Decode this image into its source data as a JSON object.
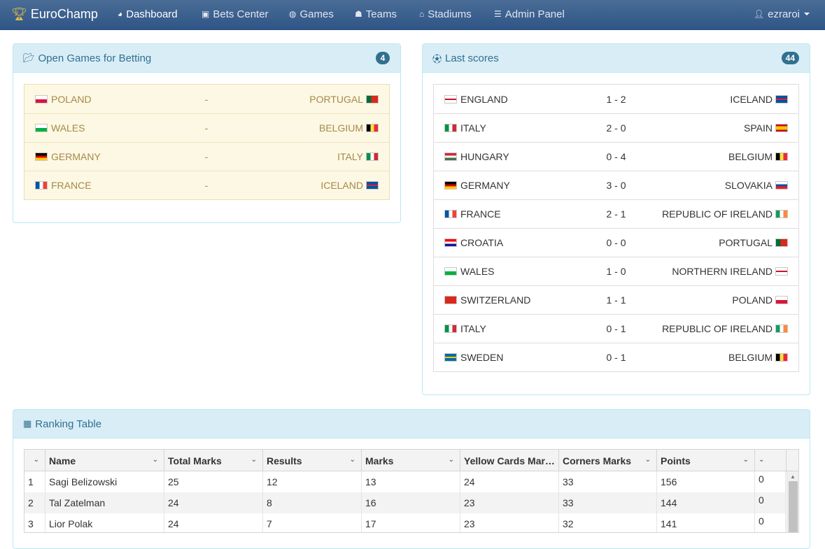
{
  "nav": {
    "brand": "EuroChamp",
    "items": [
      {
        "label": "Dashboard",
        "icon": "dashboard-icon",
        "glyph": "◕"
      },
      {
        "label": "Bets Center",
        "icon": "money-icon",
        "glyph": "▣"
      },
      {
        "label": "Games",
        "icon": "gamepad-icon",
        "glyph": "◍"
      },
      {
        "label": "Teams",
        "icon": "users-icon",
        "glyph": "☗"
      },
      {
        "label": "Stadiums",
        "icon": "home-icon",
        "glyph": "⌂"
      },
      {
        "label": "Admin Panel",
        "icon": "list-icon",
        "glyph": "☰"
      }
    ],
    "user": "ezraroi"
  },
  "open_games": {
    "title": "Open Games for Betting",
    "count": "4",
    "games": [
      {
        "home": "POLAND",
        "sep": "-",
        "away": "PORTUGAL"
      },
      {
        "home": "WALES",
        "sep": "-",
        "away": "BELGIUM"
      },
      {
        "home": "GERMANY",
        "sep": "-",
        "away": "ITALY"
      },
      {
        "home": "FRANCE",
        "sep": "-",
        "away": "ICELAND"
      }
    ]
  },
  "last_scores": {
    "title": "Last scores",
    "count": "44",
    "games": [
      {
        "home": "ENGLAND",
        "score": "1 - 2",
        "away": "ICELAND"
      },
      {
        "home": "ITALY",
        "score": "2 - 0",
        "away": "SPAIN"
      },
      {
        "home": "HUNGARY",
        "score": "0 - 4",
        "away": "BELGIUM"
      },
      {
        "home": "GERMANY",
        "score": "3 - 0",
        "away": "SLOVAKIA"
      },
      {
        "home": "FRANCE",
        "score": "2 - 1",
        "away": "REPUBLIC OF IRELAND"
      },
      {
        "home": "CROATIA",
        "score": "0 - 0",
        "away": "PORTUGAL"
      },
      {
        "home": "WALES",
        "score": "1 - 0",
        "away": "NORTHERN IRELAND"
      },
      {
        "home": "SWITZERLAND",
        "score": "1 - 1",
        "away": "POLAND"
      },
      {
        "home": "ITALY",
        "score": "0 - 1",
        "away": "REPUBLIC OF IRELAND"
      },
      {
        "home": "SWEDEN",
        "score": "0 - 1",
        "away": "BELGIUM"
      }
    ]
  },
  "ranking": {
    "title": "Ranking Table",
    "columns": [
      "",
      "Name",
      "Total Marks",
      "Results",
      "Marks",
      "Yellow Cards Mar…",
      "Corners Marks",
      "Points",
      ""
    ],
    "rows": [
      [
        "1",
        "Sagi Belizowski",
        "25",
        "12",
        "13",
        "24",
        "33",
        "156",
        "0"
      ],
      [
        "2",
        "Tal Zatelman",
        "24",
        "8",
        "16",
        "23",
        "33",
        "144",
        "0"
      ],
      [
        "3",
        "Lior Polak",
        "24",
        "7",
        "17",
        "23",
        "32",
        "141",
        "0"
      ]
    ]
  },
  "colors": {
    "navbar": "#2f5587",
    "panel_heading_bg": "#d9edf7",
    "panel_heading_text": "#31708f",
    "warning_bg": "#fcf8e3",
    "warning_text": "#a6894a"
  }
}
